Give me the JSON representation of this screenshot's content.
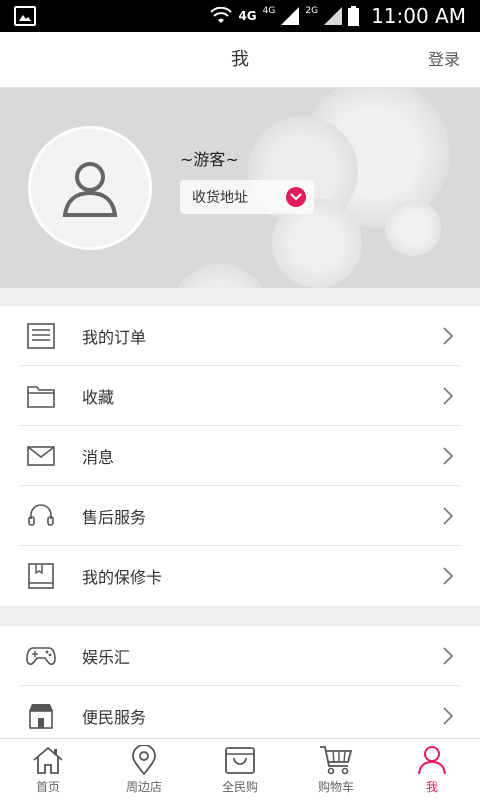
{
  "status_bar": {
    "network_1": "4G",
    "network_2": "4G",
    "network_3": "2G",
    "time": "11:00 AM"
  },
  "header": {
    "title": "我",
    "login": "登录"
  },
  "profile": {
    "username": "~游客~",
    "address_button": "收货地址"
  },
  "menu_group_1": [
    {
      "label": "我的订单",
      "icon": "order-list-icon"
    },
    {
      "label": "收藏",
      "icon": "folder-icon"
    },
    {
      "label": "消息",
      "icon": "mail-icon"
    },
    {
      "label": "售后服务",
      "icon": "headset-icon"
    },
    {
      "label": "我的保修卡",
      "icon": "warranty-card-icon"
    }
  ],
  "menu_group_2": [
    {
      "label": "娱乐汇",
      "icon": "gamepad-icon"
    },
    {
      "label": "便民服务",
      "icon": "store-icon"
    }
  ],
  "tabs": [
    {
      "label": "首页",
      "icon": "home-icon",
      "active": false
    },
    {
      "label": "周边店",
      "icon": "location-pin-icon",
      "active": false
    },
    {
      "label": "全民购",
      "icon": "shopping-bag-icon",
      "active": false
    },
    {
      "label": "购物车",
      "icon": "cart-icon",
      "active": false
    },
    {
      "label": "我",
      "icon": "user-icon",
      "active": true
    }
  ],
  "colors": {
    "accent": "#e31b5d",
    "banner_bg": "#d9d9d9",
    "text": "#333333"
  }
}
